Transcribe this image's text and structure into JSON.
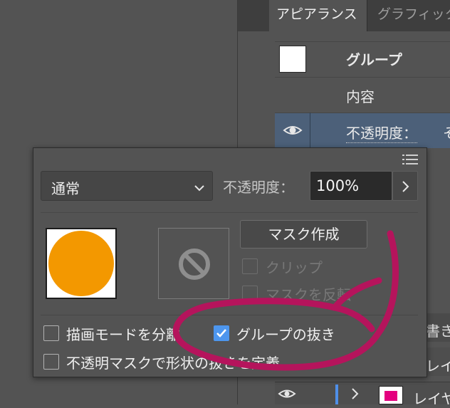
{
  "appearance_panel": {
    "tabs": [
      {
        "label": "アピアランス",
        "active": true
      },
      {
        "label": "グラフィック",
        "active": false
      }
    ],
    "rows": {
      "group_label": "グループ",
      "content_label": "内容",
      "opacity_label": "不透明度：",
      "opacity_value_partial": "そ"
    },
    "lower": {
      "partial_label": "書き",
      "layer_name_1": "レイヤ",
      "layer_name_2": "レイヤ"
    }
  },
  "transparency_dialog": {
    "blend_mode": "通常",
    "opacity_label": "不透明度：",
    "opacity_value": "100%",
    "make_mask_label": "マスク作成",
    "clip_label": "クリップ",
    "invert_mask_label": "マスクを反転",
    "isolate_blending_label": "描画モードを分離",
    "knockout_group_label": "グループの抜き",
    "opacity_mask_knockout_label": "不透明マスクで形状の抜きを定義",
    "checks": {
      "isolate_blending": false,
      "knockout_group": true,
      "opacity_mask_knockout": false,
      "clip": false,
      "invert_mask": false
    }
  },
  "colors": {
    "panel_bg": "#535353",
    "selection_row": "#4c6079",
    "checkbox_accent": "#4d96ee",
    "artwork_fill": "#f39800",
    "annotation_arrow": "#b5145c",
    "layer_swatch": "#e4007f"
  },
  "icons": [
    "eye-icon",
    "panel-menu-icon",
    "chevron-down-icon",
    "chevron-right-icon",
    "no-mask-icon"
  ]
}
